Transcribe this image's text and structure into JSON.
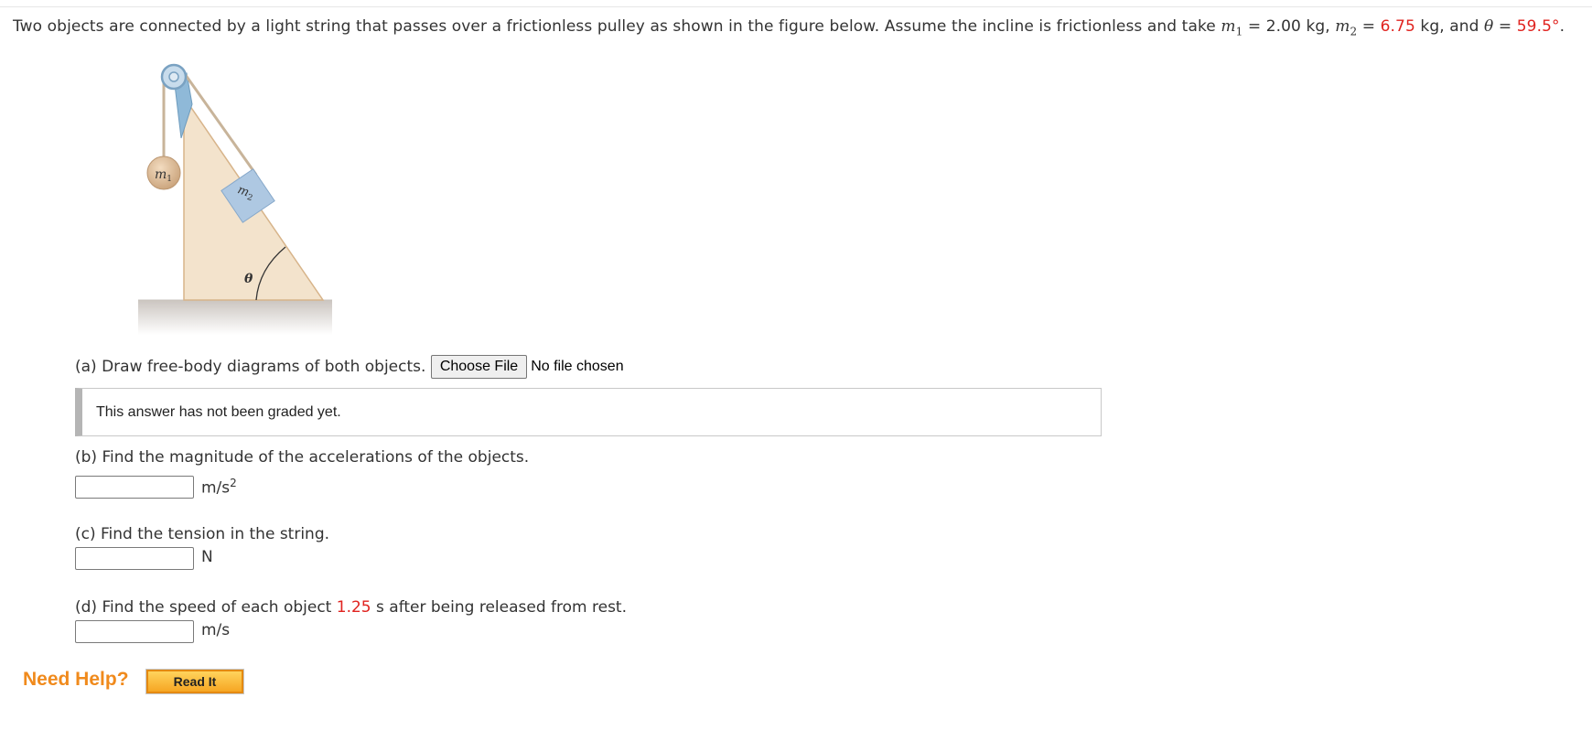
{
  "problem": {
    "intro": "Two objects are connected by a light string that passes over a frictionless pulley as shown in the figure below. Assume the incline is frictionless and take ",
    "m1_var": "m",
    "m1_sub": "1",
    "m1_value": " = 2.00 kg, ",
    "m2_var": "m",
    "m2_sub": "2",
    "eq": " = ",
    "m2_value": "6.75",
    "m2_unit": " kg, and ",
    "theta_var": "θ",
    "theta_eq": " = ",
    "theta_value": "59.5°",
    "end": "."
  },
  "figure": {
    "label_m1": "m",
    "label_m1_sub": "1",
    "label_m2": "m",
    "label_m2_sub": "2",
    "label_theta": "θ"
  },
  "part_a": {
    "text": "(a) Draw free-body diagrams of both objects.",
    "choose_file": "Choose File",
    "file_status": "No file chosen",
    "graded_note": "This answer has not been graded yet."
  },
  "part_b": {
    "text": "(b) Find the magnitude of the accelerations of the objects.",
    "answer": "",
    "unit": "m/s",
    "unit_sup": "2"
  },
  "part_c": {
    "text": "(c) Find the tension in the string.",
    "answer": "",
    "unit": "N"
  },
  "part_d": {
    "text_pre": "(d) Find the speed of each object ",
    "time_value": "1.25",
    "text_post": " s after being released from rest.",
    "answer": "",
    "unit": "m/s"
  },
  "help": {
    "label": "Need Help?",
    "read_it": "Read It"
  },
  "colors": {
    "highlight": "#e0231f",
    "help_orange": "#f08a1c"
  }
}
